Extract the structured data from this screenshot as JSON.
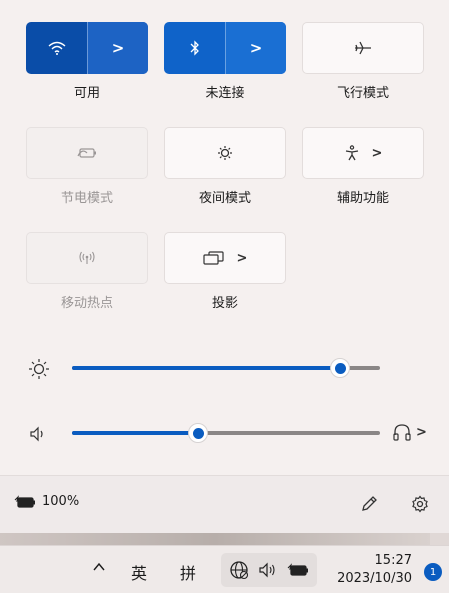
{
  "tiles": [
    {
      "label": "可用",
      "state": "on",
      "icon": "wifi-icon",
      "has_chevron": true
    },
    {
      "label": "未连接",
      "state": "on",
      "icon": "bluetooth-icon",
      "has_chevron": true
    },
    {
      "label": "飞行模式",
      "state": "off",
      "icon": "airplane-icon",
      "has_chevron": false
    },
    {
      "label": "节电模式",
      "state": "disabled",
      "icon": "battery-saver-icon",
      "has_chevron": false
    },
    {
      "label": "夜间模式",
      "state": "off",
      "icon": "night-light-icon",
      "has_chevron": false
    },
    {
      "label": "辅助功能",
      "state": "off",
      "icon": "accessibility-icon",
      "has_chevron": true
    },
    {
      "label": "移动热点",
      "state": "disabled",
      "icon": "hotspot-icon",
      "has_chevron": false
    },
    {
      "label": "投影",
      "state": "off",
      "icon": "project-icon",
      "has_chevron": true
    }
  ],
  "chevron": ">",
  "sliders": {
    "brightness": {
      "icon": "brightness-icon",
      "value": 0.87
    },
    "volume": {
      "icon": "speaker-icon",
      "value": 0.41,
      "trail_icon": "headphones-icon"
    }
  },
  "footer": {
    "battery_icon": "battery-charging-icon",
    "battery_text": "100%",
    "edit_icon": "pencil-icon",
    "settings_icon": "gear-icon"
  },
  "taskbar": {
    "overflow_chevron": "^",
    "ime_language": "英",
    "ime_mode": "拼",
    "tray_icons": [
      "network-icon",
      "speaker-icon",
      "battery-charging-icon"
    ],
    "time": "15:27",
    "date": "2023/10/30",
    "notification_count": "1"
  },
  "colors": {
    "accent": "#0a5cc0",
    "wifi_tile": "#0a4da8",
    "bluetooth_tile": "#0f63c9"
  }
}
